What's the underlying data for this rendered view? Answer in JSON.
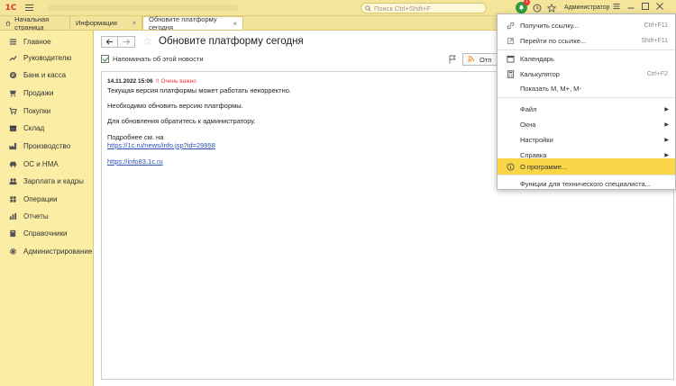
{
  "titlebar": {
    "search_placeholder": "Поиск Ctrl+Shift+F",
    "user": "Администратор",
    "notifications_count": "1"
  },
  "tabs": [
    {
      "label": "Начальная страница"
    },
    {
      "label": "Информация"
    },
    {
      "label": "Обновите платформу сегодня"
    }
  ],
  "sidebar": {
    "items": [
      {
        "label": "Главное",
        "icon": "list-icon"
      },
      {
        "label": "Руководителю",
        "icon": "trend-icon"
      },
      {
        "label": "Банк и касса",
        "icon": "coin-icon"
      },
      {
        "label": "Продажи",
        "icon": "cart-icon"
      },
      {
        "label": "Покупки",
        "icon": "basket-icon"
      },
      {
        "label": "Склад",
        "icon": "box-icon"
      },
      {
        "label": "Производство",
        "icon": "factory-icon"
      },
      {
        "label": "ОС и НМА",
        "icon": "car-icon"
      },
      {
        "label": "Зарплата и кадры",
        "icon": "people-icon"
      },
      {
        "label": "Операции",
        "icon": "cube-icon"
      },
      {
        "label": "Отчеты",
        "icon": "chart-icon"
      },
      {
        "label": "Справочники",
        "icon": "book-icon"
      },
      {
        "label": "Администрирование",
        "icon": "gear-icon"
      }
    ]
  },
  "main": {
    "title": "Обновите платформу сегодня",
    "remind_label": "Напоминать об этой новости",
    "rss_label": "Отп",
    "news": {
      "date": "14.11.2022 15:06",
      "importance": "!! Очень важно",
      "p1": "Текущая версия платформы может работать некорректно.",
      "p2": "Необходимо обновить версию платформы.",
      "p3": "Для обновления обратитесь к администратору.",
      "p4": "Подробнее см. на",
      "link1": "https://1c.ru/news/info.jsp?id=29958",
      "link2": "https://info83.1c.ru"
    }
  },
  "menu": {
    "get_link": "Получить ссылку...",
    "get_link_sc": "Ctrl+F11",
    "goto_link": "Перейти по ссылке...",
    "goto_link_sc": "Shift+F11",
    "calendar": "Календарь",
    "calculator": "Калькулятор",
    "calculator_sc": "Ctrl+F2",
    "show_m": "Показать М, М+, М-",
    "file": "Файл",
    "windows": "Окна",
    "settings": "Настройки",
    "help": "Справка",
    "about": "О программе...",
    "tech": "Функции для технического специалиста..."
  },
  "colors": {
    "background": "#fbeda4",
    "menu_highlight": "#f8d648",
    "link": "#2a4fb5",
    "important": "#e33333",
    "accent_green": "#2e9b3e"
  }
}
